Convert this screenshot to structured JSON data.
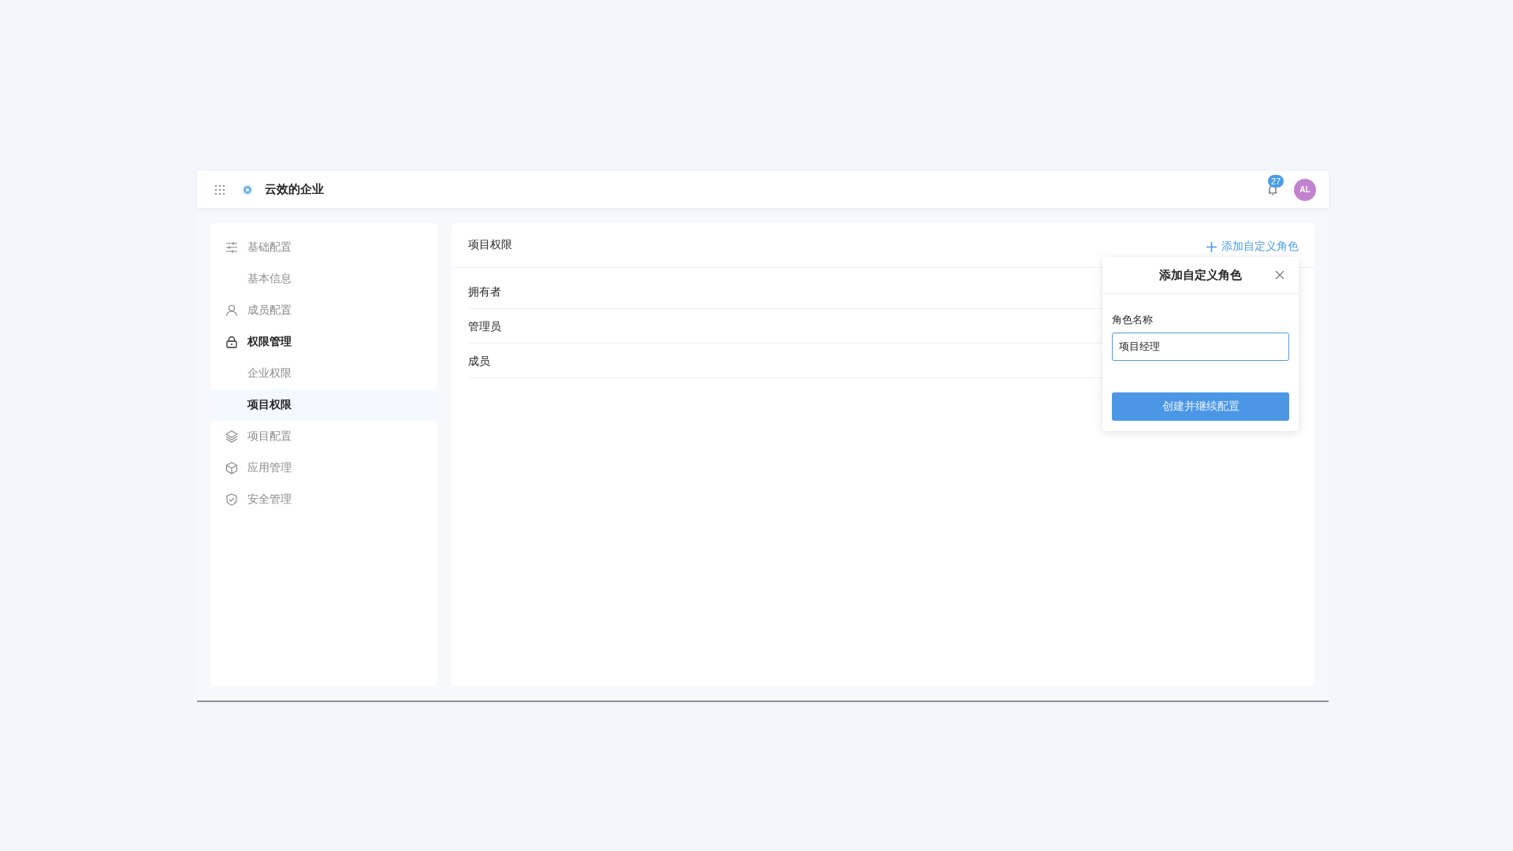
{
  "header": {
    "title": "云效的企业",
    "notifications": "27",
    "avatar": "AL"
  },
  "nav": [
    {
      "label": "基础配置",
      "selected": false,
      "children": [
        {
          "label": "基本信息",
          "selected": false
        }
      ]
    },
    {
      "label": "成员配置",
      "selected": false
    },
    {
      "label": "权限管理",
      "selected": true,
      "children": [
        {
          "label": "企业权限",
          "selected": false
        },
        {
          "label": "项目权限",
          "selected": true
        }
      ]
    },
    {
      "label": "项目配置",
      "selected": false
    },
    {
      "label": "应用管理",
      "selected": false
    },
    {
      "label": "安全管理",
      "selected": false
    }
  ],
  "panel": {
    "title": "项目权限",
    "add_link": "添加自定义角色",
    "roles": [
      "拥有者",
      "管理员",
      "成员"
    ]
  },
  "popover": {
    "title": "添加自定义角色",
    "field_label": "角色名称",
    "field_value": "项目经理",
    "submit": "创建并继续配置"
  }
}
